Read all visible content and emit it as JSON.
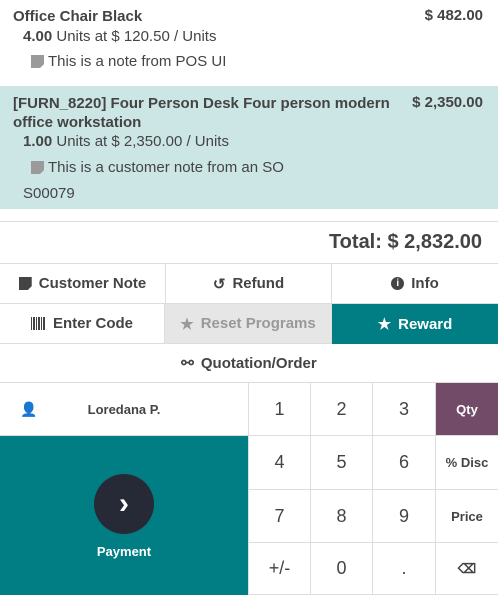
{
  "order_lines": [
    {
      "name": "Office Chair Black",
      "price": "$ 482.00",
      "qty": "4.00",
      "unit_text": "Units at $ 120.50 / Units",
      "note": "This is a note from POS UI"
    },
    {
      "name_line1": "[FURN_8220] Four Person Desk Four person modern",
      "name_line2": "office workstation",
      "price": "$ 2,350.00",
      "qty": "1.00",
      "unit_text": "Units at $ 2,350.00 / Units",
      "note": "This is a customer note from an SO",
      "origin": "S00079"
    }
  ],
  "total": "Total: $ 2,832.00",
  "actions": {
    "customer_note": "Customer Note",
    "refund": "Refund",
    "info": "Info",
    "enter_code": "Enter Code",
    "reset_programs": "Reset Programs",
    "reward": "Reward",
    "quotation": "Quotation/Order"
  },
  "customer": "Loredana P.",
  "payment": "Payment",
  "numpad": [
    "1",
    "2",
    "3",
    "Qty",
    "4",
    "5",
    "6",
    "% Disc",
    "7",
    "8",
    "9",
    "Price",
    "+/-",
    "0",
    "."
  ],
  "colors": {
    "teal": "#017e84",
    "purple": "#714b67",
    "selected_line": "#cce6e6"
  }
}
